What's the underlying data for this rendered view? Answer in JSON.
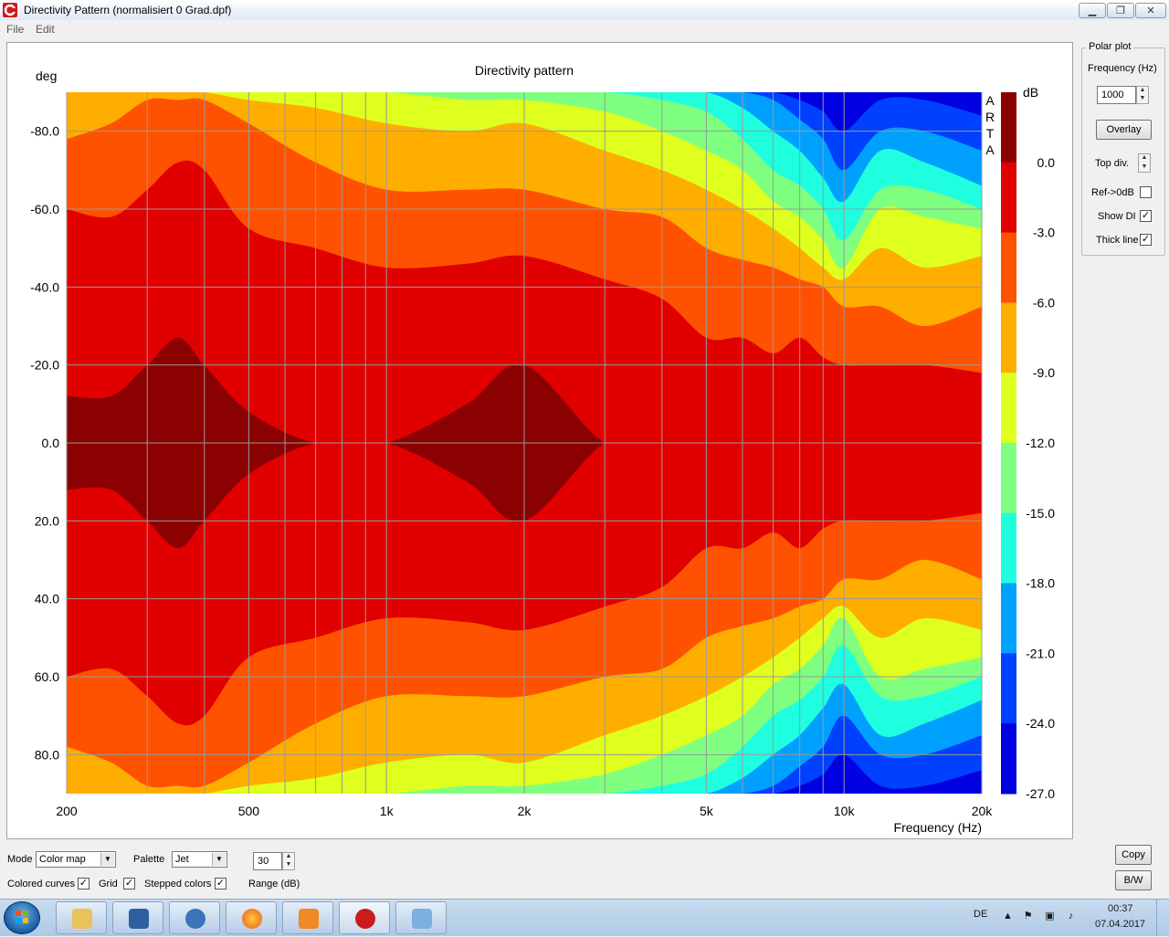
{
  "window": {
    "title": "Directivity Pattern  (normalisiert 0 Grad.dpf)",
    "icon": "arta-app-icon",
    "controls": [
      "minimize-icon",
      "maximize-icon",
      "close-icon"
    ]
  },
  "menu": {
    "items": [
      "File",
      "Edit"
    ]
  },
  "chart_data": {
    "type": "heatmap",
    "title": "Directivity pattern",
    "ylabel": "deg",
    "xlabel": "Frequency (Hz)",
    "xscale": "log",
    "xlim": [
      200,
      20000
    ],
    "ylim": [
      -90,
      90
    ],
    "y_inverted": true,
    "x_tick_values": [
      200,
      500,
      1000,
      2000,
      5000,
      10000,
      20000
    ],
    "x_tick_labels": [
      "200",
      "500",
      "1k",
      "2k",
      "5k",
      "10k",
      "20k"
    ],
    "y_tick_values": [
      -80,
      -60,
      -40,
      -20,
      0,
      20,
      40,
      60,
      80
    ],
    "y_tick_labels": [
      "-80.0",
      "-60.0",
      "-40.0",
      "-20.0",
      "0.0",
      "20.0",
      "40.0",
      "60.0",
      "80.0"
    ],
    "grid": true,
    "watermark": "ARTA",
    "colorbar": {
      "title": "dB",
      "range": [
        -27,
        3
      ],
      "tick_values": [
        0,
        -3,
        -6,
        -9,
        -12,
        -15,
        -18,
        -21,
        -24,
        -27
      ],
      "tick_labels": [
        "0.0",
        "-3.0",
        "-6.0",
        "-9.0",
        "-12.0",
        "-15.0",
        "-18.0",
        "-21.0",
        "-24.0",
        "-27.0"
      ],
      "band_colors": [
        "#8b0000",
        "#e00000",
        "#ff5200",
        "#ffae00",
        "#dfff1f",
        "#7fff7f",
        "#1fffe0",
        "#00a0ff",
        "#0040ff",
        "#0000e0"
      ]
    },
    "contour_profiles": {
      "frequencies_hz": [
        200,
        250,
        300,
        350,
        400,
        500,
        700,
        1000,
        1500,
        2000,
        3000,
        4000,
        5000,
        6000,
        7000,
        8000,
        9000,
        10000,
        12000,
        15000,
        20000
      ],
      "levels": [
        {
          "db": -3,
          "angle_limits": [
            12,
            12,
            20,
            27,
            20,
            8,
            0,
            0,
            10,
            20,
            0,
            0,
            0,
            0,
            0,
            0,
            0,
            0,
            0,
            0,
            0
          ]
        },
        {
          "db": -6,
          "angle_limits": [
            60,
            58,
            65,
            72,
            70,
            55,
            50,
            45,
            46,
            48,
            42,
            37,
            27,
            27,
            23,
            27,
            22,
            20,
            20,
            20,
            18
          ]
        },
        {
          "db": -9,
          "angle_limits": [
            78,
            82,
            88,
            88,
            88,
            82,
            72,
            65,
            65,
            65,
            60,
            58,
            50,
            47,
            45,
            42,
            40,
            35,
            35,
            30,
            35
          ]
        },
        {
          "db": -12,
          "angle_limits": [
            90,
            90,
            90,
            90,
            90,
            88,
            86,
            82,
            80,
            82,
            75,
            70,
            65,
            60,
            55,
            50,
            45,
            42,
            50,
            45,
            48
          ]
        },
        {
          "db": -15,
          "angle_limits": [
            90,
            90,
            90,
            90,
            90,
            90,
            90,
            90,
            88,
            88,
            85,
            80,
            75,
            70,
            62,
            58,
            52,
            45,
            60,
            58,
            55
          ]
        },
        {
          "db": -18,
          "angle_limits": [
            90,
            90,
            90,
            90,
            90,
            90,
            90,
            90,
            90,
            90,
            90,
            88,
            85,
            78,
            70,
            66,
            60,
            52,
            65,
            65,
            60
          ]
        },
        {
          "db": -21,
          "angle_limits": [
            90,
            90,
            90,
            90,
            90,
            90,
            90,
            90,
            90,
            90,
            90,
            90,
            90,
            86,
            80,
            75,
            68,
            62,
            75,
            72,
            66
          ]
        },
        {
          "db": -24,
          "angle_limits": [
            90,
            90,
            90,
            90,
            90,
            90,
            90,
            90,
            90,
            90,
            90,
            90,
            90,
            90,
            88,
            83,
            78,
            70,
            80,
            80,
            75
          ]
        },
        {
          "db": -27,
          "angle_limits": [
            90,
            90,
            90,
            90,
            90,
            90,
            90,
            90,
            90,
            90,
            90,
            90,
            90,
            90,
            90,
            88,
            85,
            80,
            88,
            88,
            84
          ]
        }
      ]
    }
  },
  "polar_plot": {
    "group_label": "Polar plot",
    "frequency_label": "Frequency (Hz)",
    "frequency_value": "1000",
    "overlay_label": "Overlay",
    "top_div_label": "Top div.",
    "ref_label": "Ref->0dB",
    "ref_checked": false,
    "show_di_label": "Show DI",
    "show_di_checked": true,
    "thick_line_label": "Thick line",
    "thick_line_checked": true
  },
  "bottom": {
    "mode_label": "Mode",
    "mode_value": "Color map",
    "palette_label": "Palette",
    "palette_value": "Jet",
    "range_value": "30",
    "range_label": "Range (dB)",
    "colored_curves_label": "Colored curves",
    "colored_curves_checked": true,
    "grid_label": "Grid",
    "grid_checked": true,
    "stepped_colors_label": "Stepped colors",
    "stepped_colors_checked": true,
    "copy_label": "Copy",
    "bw_label": "B/W"
  },
  "taskbar": {
    "apps": [
      "file-explorer-icon",
      "network-tool-icon",
      "thunderbird-icon",
      "firefox-icon",
      "media-player-icon",
      "arta-icon",
      "paint-icon"
    ],
    "language": "DE",
    "time": "00:37",
    "date": "07.04.2017"
  }
}
